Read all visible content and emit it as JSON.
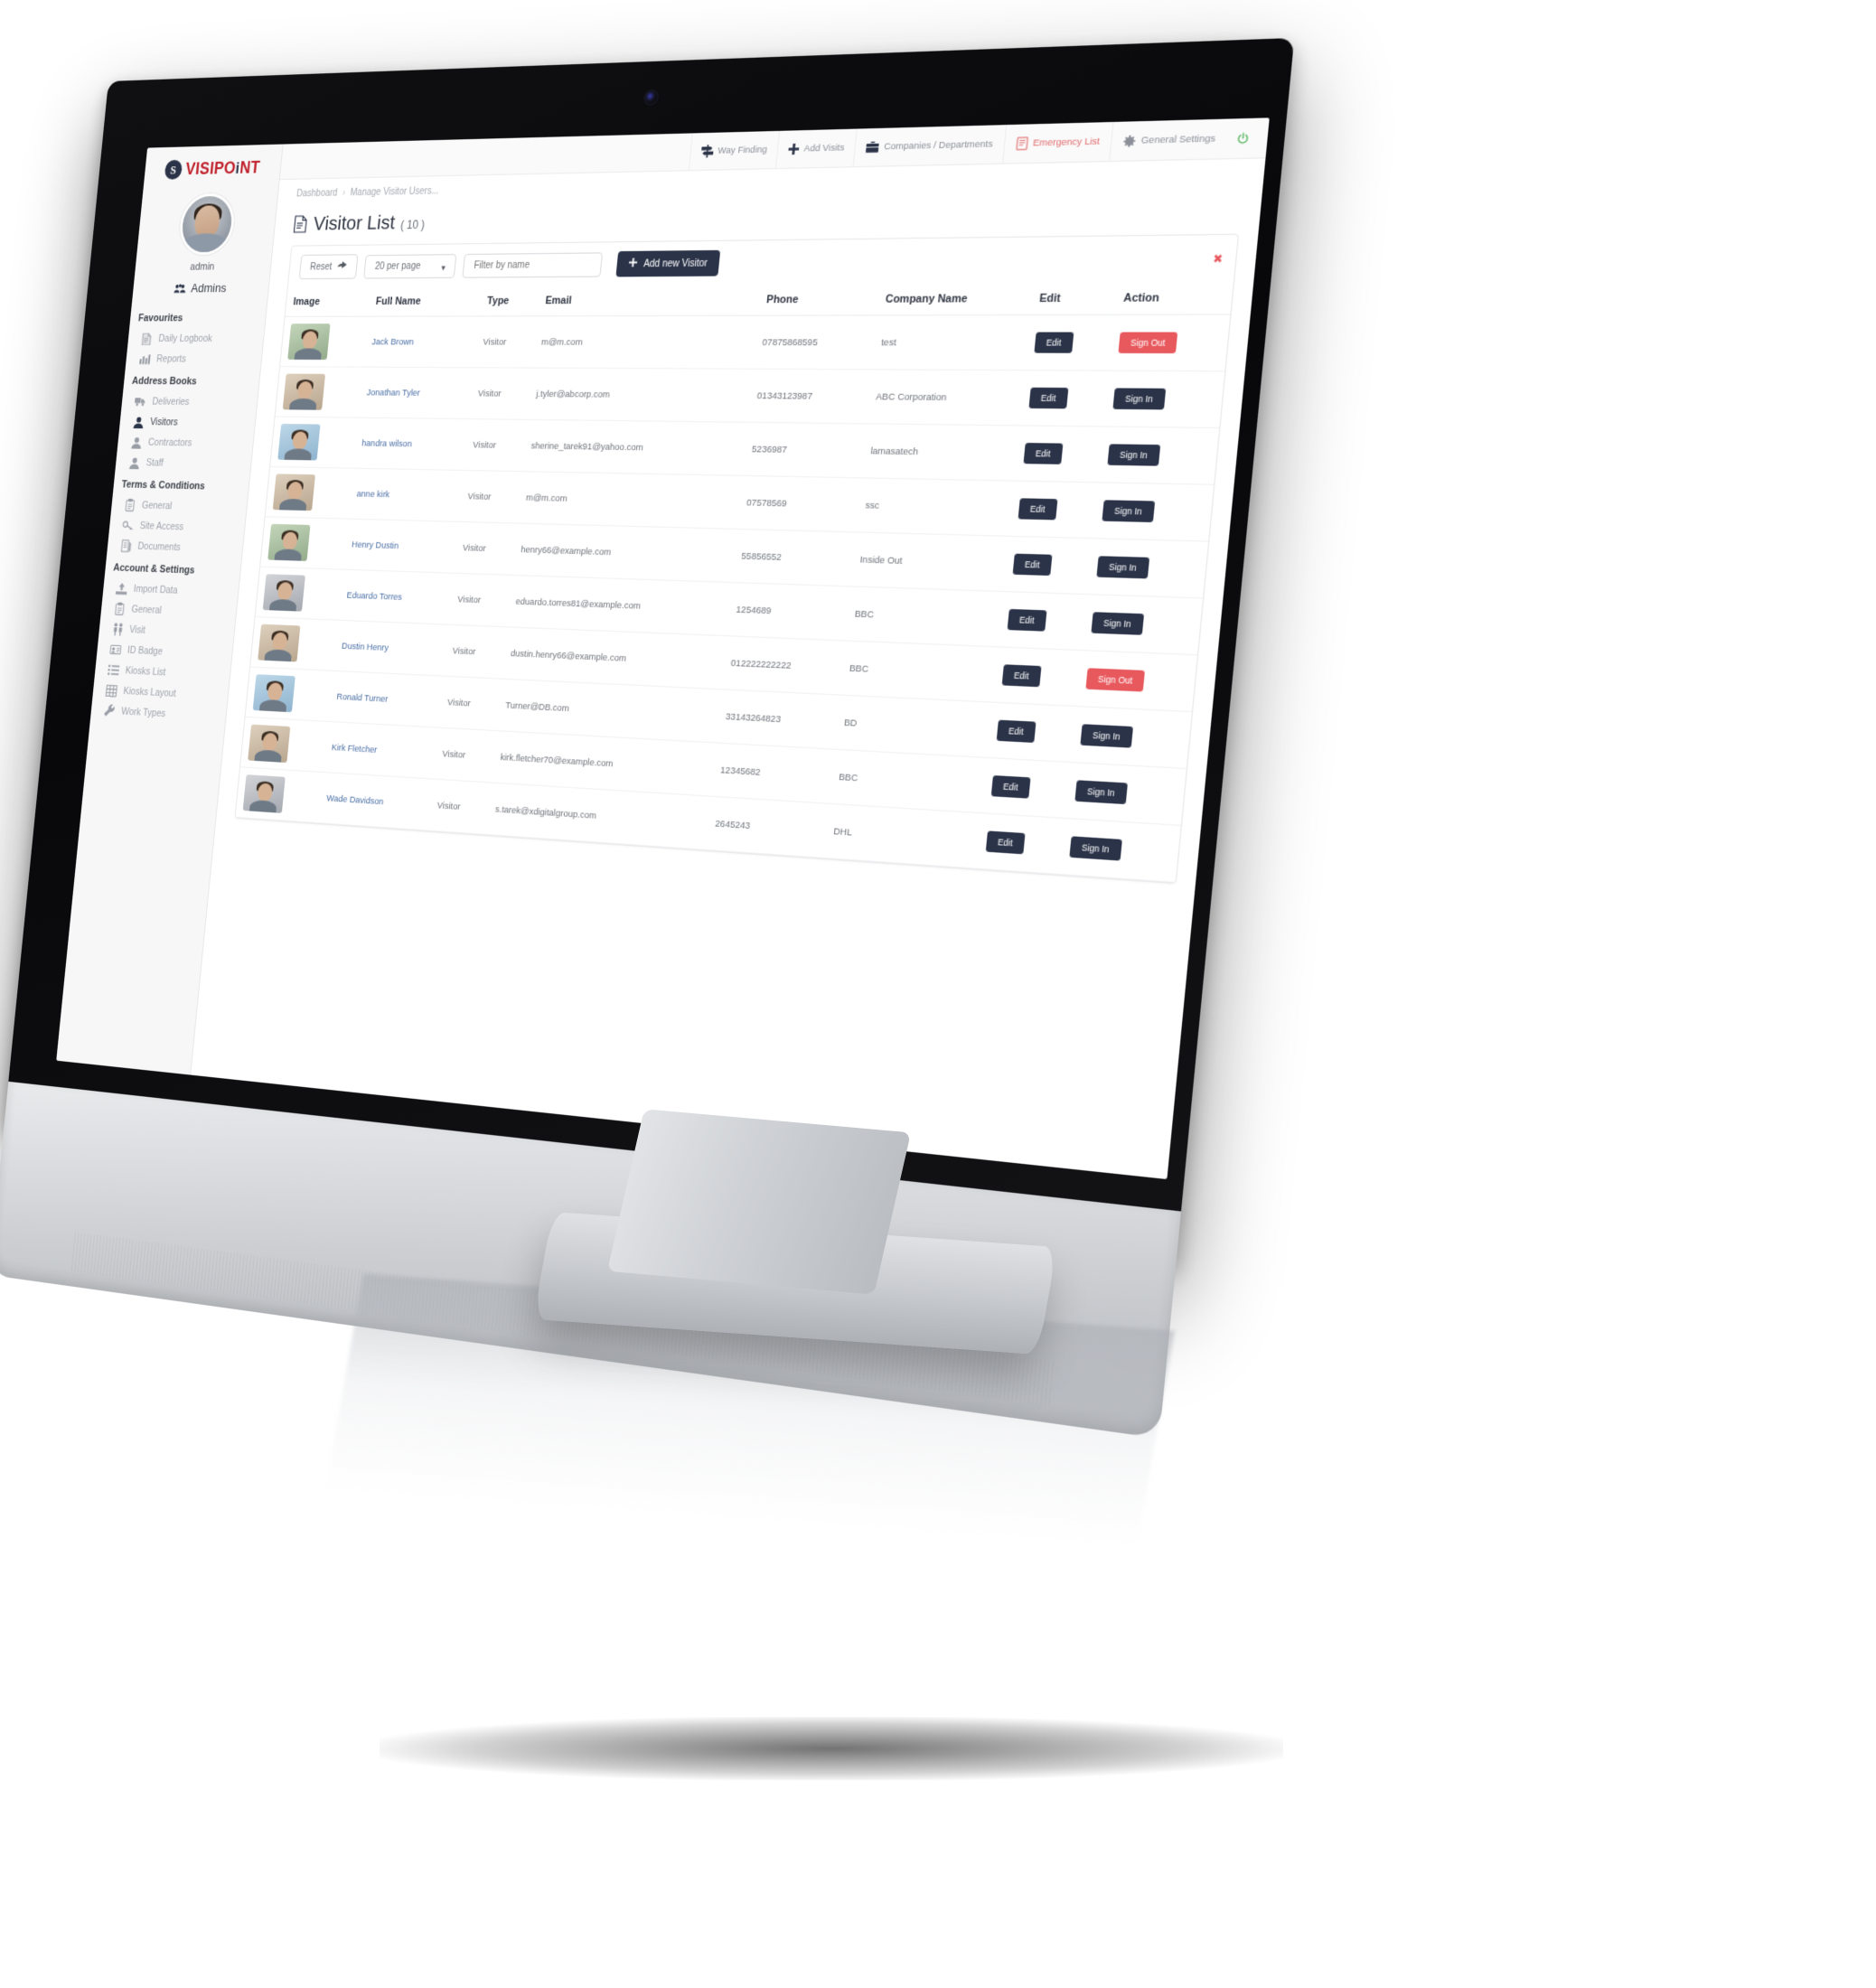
{
  "brand": {
    "name_part1": "VISIPO",
    "name_i": "i",
    "name_part2": "NT",
    "logo_glyph": "S"
  },
  "sidebar": {
    "username": "admin",
    "admins_label": "Admins",
    "groups": [
      {
        "title": "Favourites",
        "items": [
          {
            "label": "Daily Logbook",
            "icon": "document-icon",
            "active": false
          },
          {
            "label": "Reports",
            "icon": "bar-chart-icon",
            "active": false
          }
        ]
      },
      {
        "title": "Address Books",
        "items": [
          {
            "label": "Deliveries",
            "icon": "truck-icon",
            "active": false
          },
          {
            "label": "Visitors",
            "icon": "user-icon",
            "active": true
          },
          {
            "label": "Contractors",
            "icon": "user-icon",
            "active": false
          },
          {
            "label": "Staff",
            "icon": "user-icon",
            "active": false
          }
        ]
      },
      {
        "title": "Terms & Conditions",
        "items": [
          {
            "label": "General",
            "icon": "clipboard-icon",
            "active": false
          },
          {
            "label": "Site Access",
            "icon": "key-icon",
            "active": false
          },
          {
            "label": "Documents",
            "icon": "documents-icon",
            "active": false
          }
        ]
      },
      {
        "title": "Account & Settings",
        "items": [
          {
            "label": "Import Data",
            "icon": "upload-icon",
            "active": false
          },
          {
            "label": "General",
            "icon": "clipboard-icon",
            "active": false
          },
          {
            "label": "Visit",
            "icon": "people-icon",
            "active": false
          },
          {
            "label": "ID Badge",
            "icon": "badge-icon",
            "active": false
          },
          {
            "label": "Kiosks List",
            "icon": "list-icon",
            "active": false
          },
          {
            "label": "Kiosks Layout",
            "icon": "grid-icon",
            "active": false
          },
          {
            "label": "Work Types",
            "icon": "wrench-icon",
            "active": false
          }
        ]
      }
    ]
  },
  "topnav": {
    "items": [
      {
        "label": "Way Finding",
        "icon": "signpost-icon",
        "danger": false
      },
      {
        "label": "Add Visits",
        "icon": "plus-icon",
        "danger": false
      },
      {
        "label": "Companies / Departments",
        "icon": "briefcase-icon",
        "danger": false
      },
      {
        "label": "Emergency List",
        "icon": "emergency-doc-icon",
        "danger": true
      },
      {
        "label": "General Settings",
        "icon": "gear-icon",
        "danger": false
      }
    ],
    "power_icon": "power-icon",
    "power_color": "#4caf50"
  },
  "breadcrumb": {
    "root": "Dashboard",
    "separator": "›",
    "current": "Manage Visitor Users..."
  },
  "page": {
    "title": "Visitor List",
    "count": "( 10 )",
    "title_icon": "document-icon"
  },
  "toolbar": {
    "reset_label": "Reset",
    "reset_icon": "reset-arrow-icon",
    "per_page_value": "20 per page",
    "per_page_caret": "▼",
    "filter_placeholder": "Filter by name",
    "filter_value": "",
    "add_label": "Add new Visitor",
    "add_icon": "plus-icon",
    "close_icon": "✖"
  },
  "table": {
    "columns": [
      "Image",
      "Full Name",
      "Type",
      "Email",
      "Phone",
      "Company Name",
      "Edit",
      "Action"
    ],
    "rows": [
      {
        "name": "Jack Brown",
        "type": "Visitor",
        "email": "m@m.com",
        "phone": "07875868595",
        "company": "test",
        "edit": "Edit",
        "action": "Sign Out",
        "action_kind": "signout",
        "thumb": "green"
      },
      {
        "name": "Jonathan Tyler",
        "type": "Visitor",
        "email": "j.tyler@abcorp.com",
        "phone": "01343123987",
        "company": "ABC Corporation",
        "edit": "Edit",
        "action": "Sign In",
        "action_kind": "signin",
        "thumb": "warm"
      },
      {
        "name": "handra wilson",
        "type": "Visitor",
        "email": "sherine_tarek91@yahoo.com",
        "phone": "5236987",
        "company": "lamasatech",
        "edit": "Edit",
        "action": "Sign In",
        "action_kind": "signin",
        "thumb": "sky"
      },
      {
        "name": "anne kirk",
        "type": "Visitor",
        "email": "m@m.com",
        "phone": "07578569",
        "company": "ssc",
        "edit": "Edit",
        "action": "Sign In",
        "action_kind": "signin",
        "thumb": "warm"
      },
      {
        "name": "Henry Dustin",
        "type": "Visitor",
        "email": "henry66@example.com",
        "phone": "55856552",
        "company": "Inside Out",
        "edit": "Edit",
        "action": "Sign In",
        "action_kind": "signin",
        "thumb": "green"
      },
      {
        "name": "Eduardo Torres",
        "type": "Visitor",
        "email": "eduardo.torres81@example.com",
        "phone": "1254689",
        "company": "BBC",
        "edit": "Edit",
        "action": "Sign In",
        "action_kind": "signin",
        "thumb": "grey"
      },
      {
        "name": "Dustin Henry",
        "type": "Visitor",
        "email": "dustin.henry66@example.com",
        "phone": "012222222222",
        "company": "BBC",
        "edit": "Edit",
        "action": "Sign Out",
        "action_kind": "signout",
        "thumb": "warm"
      },
      {
        "name": "Ronald Turner",
        "type": "Visitor",
        "email": "Turner@DB.com",
        "phone": "33143264823",
        "company": "BD",
        "edit": "Edit",
        "action": "Sign In",
        "action_kind": "signin",
        "thumb": "sky"
      },
      {
        "name": "Kirk Fletcher",
        "type": "Visitor",
        "email": "kirk.fletcher70@example.com",
        "phone": "12345682",
        "company": "BBC",
        "edit": "Edit",
        "action": "Sign In",
        "action_kind": "signin",
        "thumb": "warm"
      },
      {
        "name": "Wade Davidson",
        "type": "Visitor",
        "email": "s.tarek@xdigitalgroup.com",
        "phone": "2645243",
        "company": "DHL",
        "edit": "Edit",
        "action": "Sign In",
        "action_kind": "signin",
        "thumb": "grey"
      }
    ]
  },
  "colors": {
    "brand_red": "#c0202a",
    "dark_navy": "#2b3348",
    "danger_red": "#e8595e",
    "link_blue": "#4a6fa5",
    "power_green": "#4caf50"
  }
}
